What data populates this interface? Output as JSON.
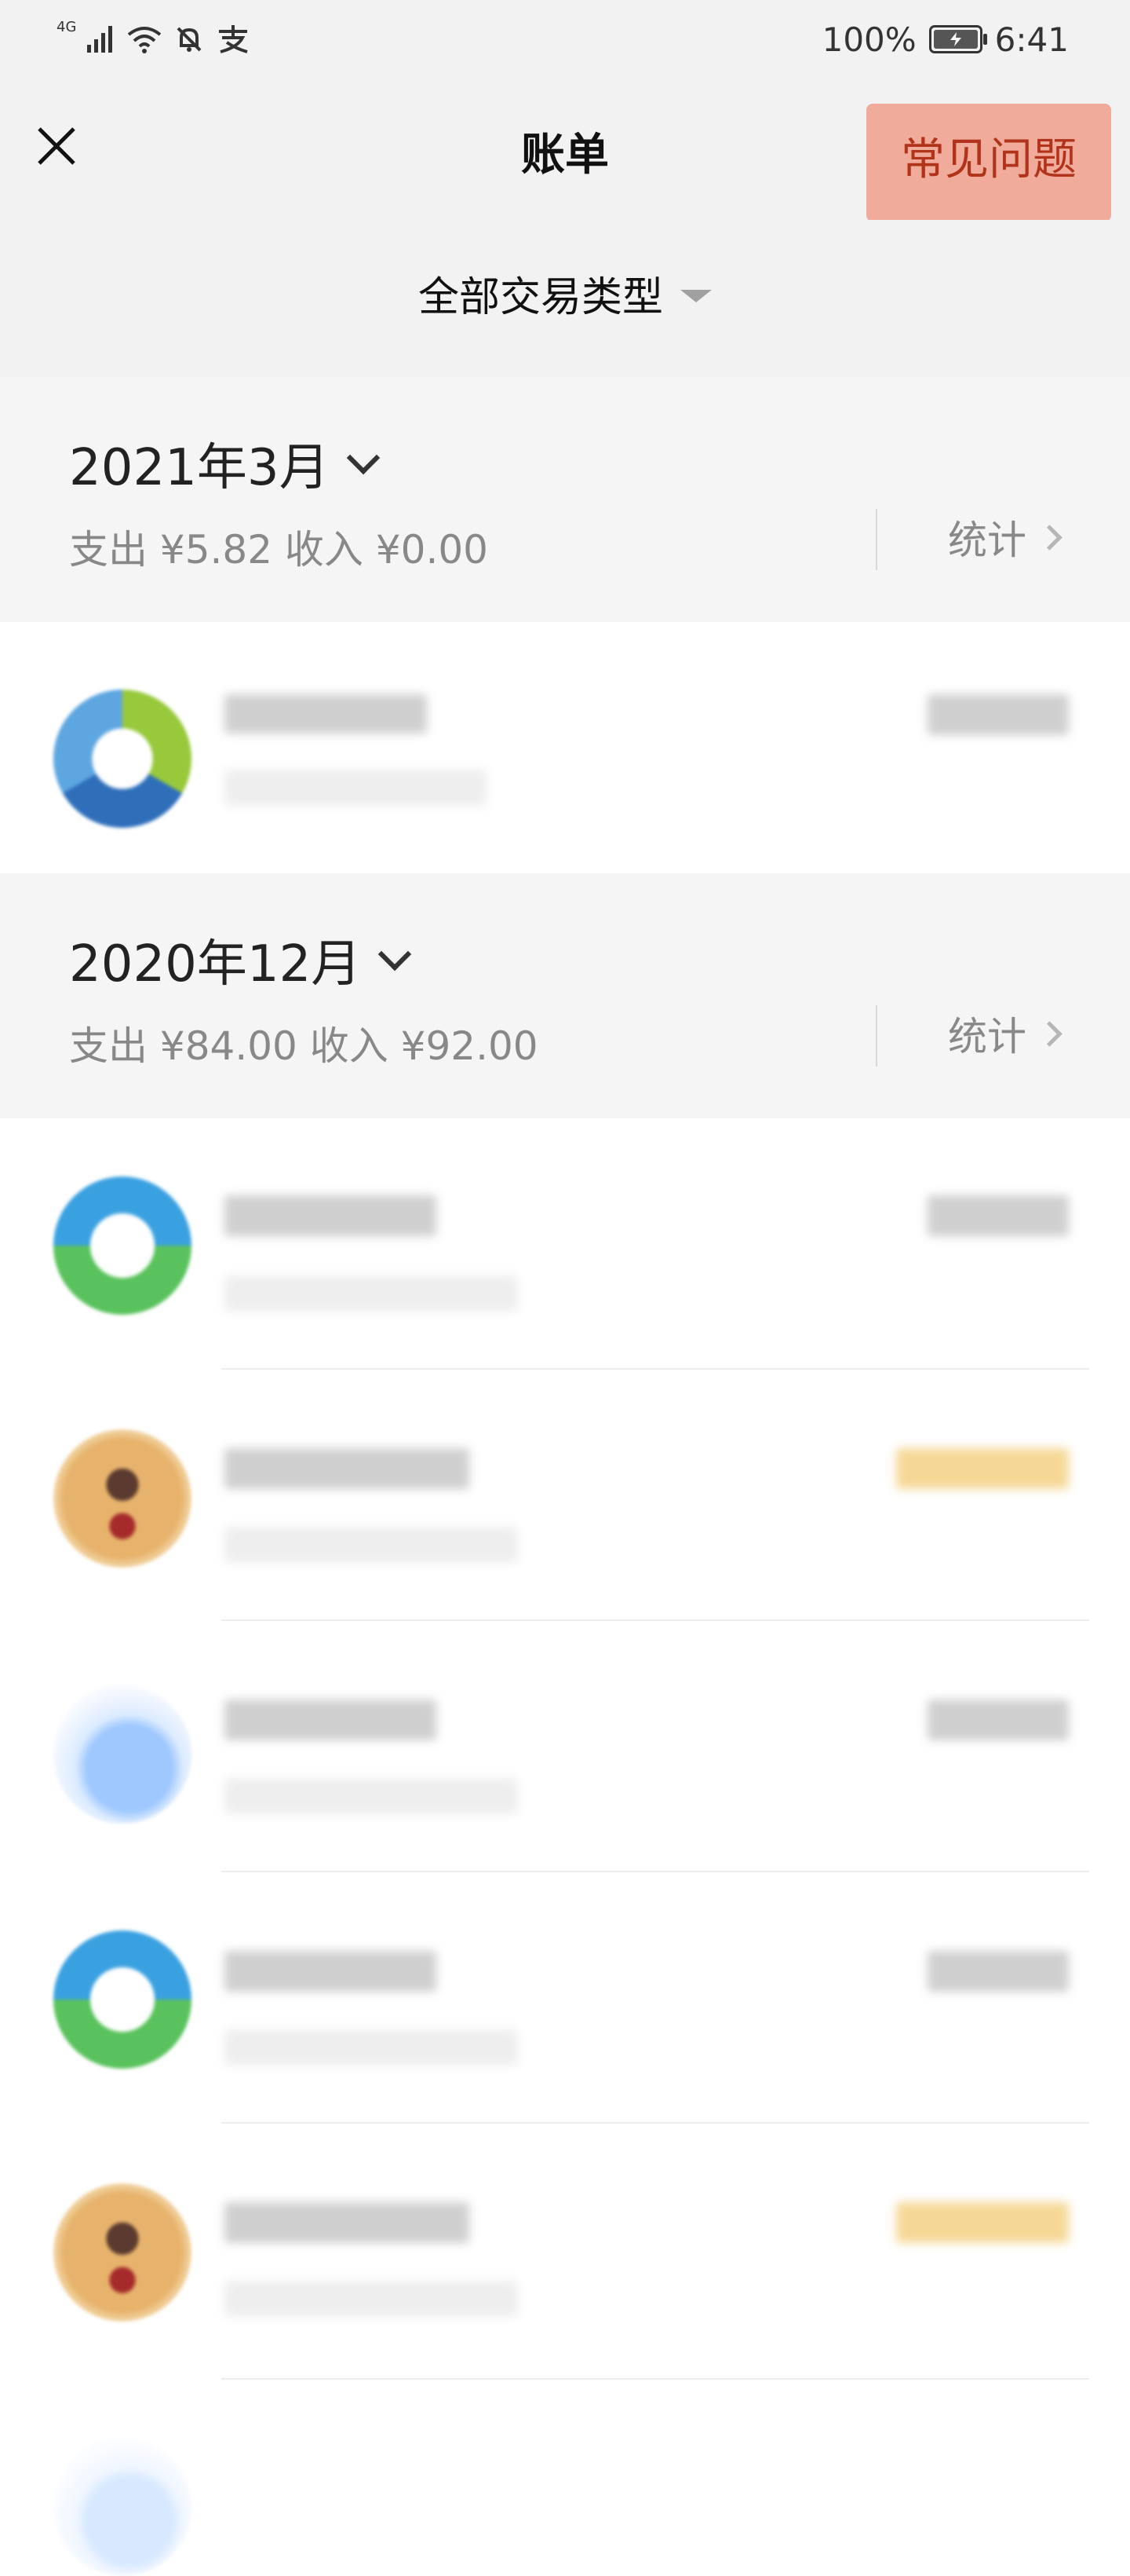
{
  "status_bar": {
    "network": "4G",
    "battery": "100%",
    "time": "6:41",
    "icons": [
      "signal-icon",
      "wifi-icon",
      "mute-icon",
      "alipay-icon"
    ]
  },
  "header": {
    "title": "账单",
    "close_icon": "close-icon",
    "faq_label": "常见问题",
    "faq_color": "#f0ab9b"
  },
  "filter": {
    "label": "全部交易类型",
    "icon": "caret-down-icon"
  },
  "months": [
    {
      "title": "2021年3月",
      "summary": "支出 ¥5.82 收入 ¥0.00",
      "stats_label": "统计",
      "transactions": [
        {
          "avatar": "ring-logo-alt",
          "type": "expense"
        }
      ]
    },
    {
      "title": "2020年12月",
      "summary": "支出 ¥84.00 收入 ¥92.00",
      "stats_label": "统计",
      "transactions": [
        {
          "avatar": "ring-logo",
          "type": "expense"
        },
        {
          "avatar": "face-photo",
          "type": "income"
        },
        {
          "avatar": "cloud-logo",
          "type": "expense"
        },
        {
          "avatar": "ring-logo",
          "type": "expense"
        },
        {
          "avatar": "face-photo",
          "type": "income"
        }
      ]
    }
  ],
  "colors": {
    "expense_amount": "#cfcfcf",
    "income_amount": "#f5d896",
    "header_bg": "#f2f2f2"
  }
}
